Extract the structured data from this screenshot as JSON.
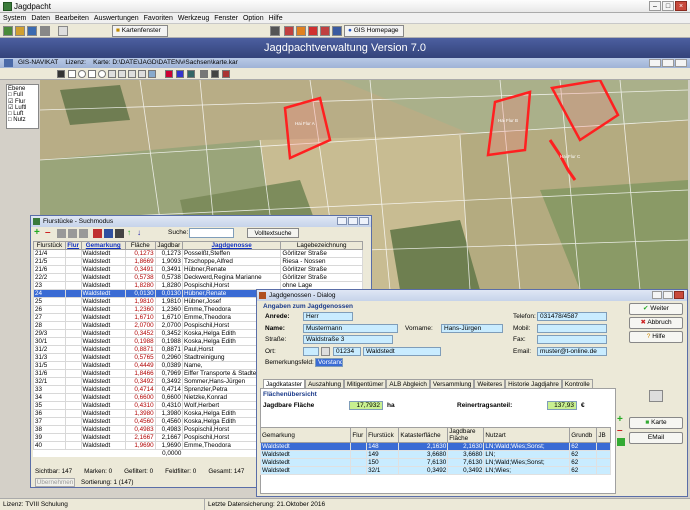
{
  "app": {
    "title": "Jagdpacht",
    "banner": "Jagdpachtverwaltung Version 7.0"
  },
  "menu": [
    "System",
    "Daten",
    "Bearbeiten",
    "Auswertungen",
    "Favoriten",
    "Werkzeug",
    "Fenster",
    "Option",
    "Hilfe"
  ],
  "toolbar": {
    "karten_label": "Kartenfenster",
    "gis_label": "GIS Homepage"
  },
  "gis": {
    "title": "GIS-NAVIKAT",
    "lizenz": "Lizenz:",
    "karte": "Karte: D:\\DATE\\JAGD\\DATEN\\#Sachsen\\karte.kar"
  },
  "layers": {
    "title": "Ebene",
    "items": [
      "Full",
      "Flur",
      "Luftl",
      "Luft",
      "Nutz"
    ]
  },
  "map_labels": [
    "Hai Flur A",
    "Hai Flur B",
    "Hai Flur C"
  ],
  "flur": {
    "title": "Flurstücke - Suchmodus",
    "suche_label": "Suche:",
    "volltext_button": "Volltextsuche",
    "columns": [
      "Flurstück",
      "Flur",
      "Gemarkung",
      "Fläche",
      "Jagdbar",
      "Jagdgenosse",
      "Lagebezeichnung"
    ],
    "rows": [
      [
        "21/4",
        "",
        "Waldstedt",
        "0,1273",
        "0,1273",
        "Posselßt,Steffen",
        "Görlitzer Straße"
      ],
      [
        "21/5",
        "",
        "Waldstedt",
        "1,8669",
        "1,9093",
        "Tzschoppe,Alfred",
        "Riesa - Nossen"
      ],
      [
        "21/6",
        "",
        "Waldstedt",
        "0,3491",
        "0,3491",
        "Hübner,Renate",
        "Görlitzer Straße"
      ],
      [
        "22/2",
        "",
        "Waldstedt",
        "0,5738",
        "0,5738",
        "Deckwerd,Regina Marianne",
        "Görlitzer Straße"
      ],
      [
        "23",
        "",
        "Waldstedt",
        "1,8280",
        "1,8280",
        "Pospischil,Horst",
        "ohne Lage"
      ],
      [
        "24",
        "",
        "Waldstedt",
        "0,0130",
        "0,0130",
        "Hübner,Renate",
        ""
      ],
      [
        "25",
        "",
        "Waldstedt",
        "1,9810",
        "1,9810",
        "Hübner,Josef",
        ""
      ],
      [
        "26",
        "",
        "Waldstedt",
        "1,2360",
        "1,2360",
        "Emme,Theodora",
        ""
      ],
      [
        "27",
        "",
        "Waldstedt",
        "1,6710",
        "1,6710",
        "Emme,Theodora",
        ""
      ],
      [
        "28",
        "",
        "Waldstedt",
        "2,0700",
        "2,0700",
        "Pospischil,Horst",
        ""
      ],
      [
        "29/3",
        "",
        "Waldstedt",
        "0,3452",
        "0,3452",
        "Koska,Helga Edith",
        ""
      ],
      [
        "30/1",
        "",
        "Waldstedt",
        "0,1988",
        "0,1988",
        "Koska,Helga Edith",
        ""
      ],
      [
        "31/2",
        "",
        "Waldstedt",
        "0,8871",
        "0,8871",
        "Paul,Horst",
        ""
      ],
      [
        "31/3",
        "",
        "Waldstedt",
        "0,5765",
        "0,2960",
        "Stadtreinigung",
        ""
      ],
      [
        "31/5",
        "",
        "Waldstedt",
        "0,4449",
        "0,0389",
        "Name,",
        ""
      ],
      [
        "31/6",
        "",
        "Waldstedt",
        "1,8466",
        "0,7969",
        "Eiffer Transporte & Stadtere",
        ""
      ],
      [
        "32/1",
        "",
        "Waldstedt",
        "0,3492",
        "0,3492",
        "Sommer,Hans-Jürgen",
        ""
      ],
      [
        "33",
        "",
        "Waldstedt",
        "0,4714",
        "0,4714",
        "Sprenzler,Petra",
        ""
      ],
      [
        "34",
        "",
        "Waldstedt",
        "0,6600",
        "0,6600",
        "Nietzke,Konrad",
        ""
      ],
      [
        "35",
        "",
        "Waldstedt",
        "0,4310",
        "0,4310",
        "Wolf,Herbert",
        ""
      ],
      [
        "36",
        "",
        "Waldstedt",
        "1,3980",
        "1,3980",
        "Koska,Helga Edith",
        ""
      ],
      [
        "37",
        "",
        "Waldstedt",
        "0,4560",
        "0,4560",
        "Koska,Helga Edith",
        ""
      ],
      [
        "38",
        "",
        "Waldstedt",
        "0,4983",
        "0,4983",
        "Pospischil,Horst",
        ""
      ],
      [
        "39",
        "",
        "Waldstedt",
        "2,1667",
        "2,1667",
        "Pospischil,Horst",
        ""
      ],
      [
        "40",
        "",
        "Waldstedt",
        "1,9690",
        "1,9690",
        "Emme,Theodora",
        ""
      ]
    ],
    "total": "0,0000",
    "summary": {
      "sichtbar": "Sichtbar: 147",
      "marken": "Marken: 0",
      "gefiltert": "Gefiltert: 0",
      "feldfilter": "Feldfilter: 0",
      "gesamt": "Gesamt: 147"
    },
    "uebernehmen": "Übernehmen",
    "sortierung": "Sortierung: 1 (147)"
  },
  "dialog": {
    "title": "Jagdgenossen - Dialog",
    "section": "Angaben zum Jagdgenossen",
    "anrede_label": "Anrede:",
    "anrede": "Herr",
    "name_label": "Name:",
    "name": "Mustermann",
    "vorname_label": "Vorname:",
    "vorname": "Hans-Jürgen",
    "strasse_label": "Straße:",
    "strasse": "Waldstraße 3",
    "ort_label": "Ort:",
    "plz": "01234",
    "ort": "Waldstedt",
    "bemerkung_label": "Bemerkungsfeld:",
    "bemerkung": "Vorstand",
    "telefon_label": "Telefon:",
    "telefon": "031478/4587",
    "mobil_label": "Mobil:",
    "fax_label": "Fax:",
    "email_label": "Email:",
    "email": "muster@t-online.de",
    "tabs": [
      "Jagdkataster",
      "Auszahlung",
      "Mitigentümer",
      "ALB Abgleich",
      "Versammlung",
      "Weiteres",
      "Historie Jagdjahre",
      "Kontrolle"
    ],
    "flaechen_title": "Flächenübersicht",
    "jagdbar_label": "Jagdbare Fläche",
    "jagdbar": "17,7932",
    "unit_ha": "ha",
    "rein_label": "Reinertragsanteil:",
    "rein": "137,93",
    "unit_eur": "€",
    "table_cols": [
      "Gemarkung",
      "Flur",
      "Flurstück",
      "Katasterfläche",
      "Jagdbare Fläche",
      "Nutzart",
      "Grundb",
      "JB"
    ],
    "table_rows": [
      [
        "Waldstedt",
        "",
        "148",
        "2,1630",
        "2,1630",
        "LN;Wald;Wies;Sonst;",
        "62",
        ""
      ],
      [
        "Waldstedt",
        "",
        "149",
        "3,6680",
        "3,6680",
        "LN;",
        "62",
        ""
      ],
      [
        "Waldstedt",
        "",
        "150",
        "7,6130",
        "7,6130",
        "LN;Wald;Wies;Sonst;",
        "62",
        ""
      ],
      [
        "Waldstedt",
        "",
        "32/1",
        "0,3492",
        "0,3492",
        "LN;Wies;",
        "62",
        ""
      ]
    ],
    "buttons": {
      "weiter": "Weiter",
      "abbruch": "Abbruch",
      "hilfe": "Hilfe",
      "karte": "Karte",
      "email": "EMail"
    }
  },
  "status": {
    "lizenz": "Lizenz: TVIII Schulung",
    "datensicherung": "Letzte Datensicherung: 21.Oktober 2016"
  }
}
